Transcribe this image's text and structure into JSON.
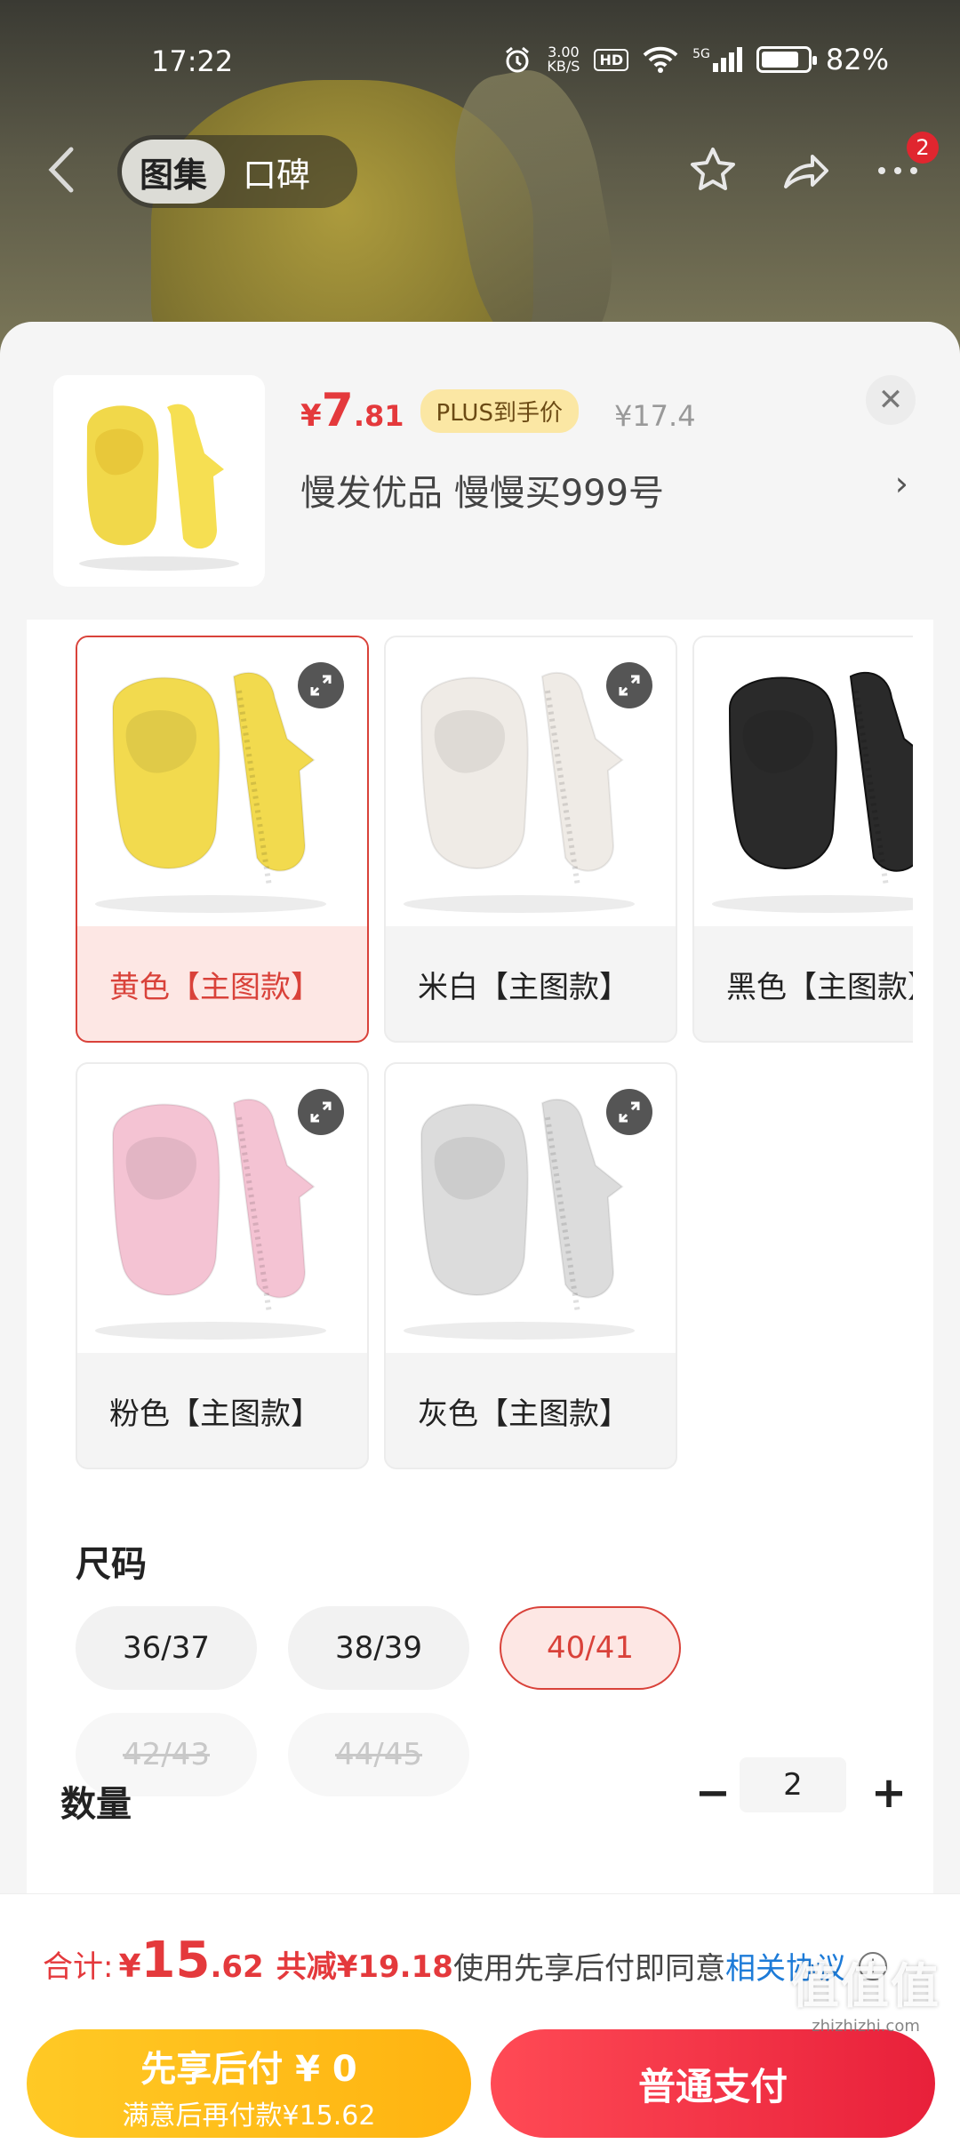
{
  "status_bar": {
    "time": "17:22",
    "net_speed_value": "3.00",
    "net_speed_unit": "KB/S",
    "hd": "HD",
    "signal_label": "5G",
    "battery": "82%",
    "battery_level": 0.82
  },
  "nav": {
    "tabs": [
      {
        "label": "图集",
        "active": true
      },
      {
        "label": "口碑",
        "active": false
      }
    ],
    "more_badge": "2",
    "icons": [
      "back-arrow-icon",
      "star-icon",
      "share-icon",
      "more-icon"
    ]
  },
  "product": {
    "price_currency": "¥",
    "price_int": "7",
    "price_dec": ".81",
    "price_tag": "PLUS到手价",
    "original_price": "¥17.4",
    "shop_name": "慢发优品  慢慢买999号",
    "close_glyph": "✕",
    "arrow_glyph": "›"
  },
  "colors": [
    {
      "label": "黄色【主图款】",
      "selected": true,
      "shoe_color": "#f2da4e"
    },
    {
      "label": "米白【主图款】",
      "selected": false,
      "shoe_color": "#efebe6"
    },
    {
      "label": "黑色【主图款】",
      "selected": false,
      "shoe_color": "#2a2a2a"
    },
    {
      "label": "粉色【主图款】",
      "selected": false,
      "shoe_color": "#f4c3d3"
    },
    {
      "label": "灰色【主图款】",
      "selected": false,
      "shoe_color": "#dcdcdc"
    }
  ],
  "size": {
    "title": "尺码",
    "options": [
      {
        "label": "36/37",
        "state": "normal"
      },
      {
        "label": "38/39",
        "state": "normal"
      },
      {
        "label": "40/41",
        "state": "selected"
      },
      {
        "label": "42/43",
        "state": "disabled"
      },
      {
        "label": "44/45",
        "state": "disabled"
      }
    ]
  },
  "quantity": {
    "title": "数量",
    "value": "2",
    "minus": "−",
    "plus": "+"
  },
  "footer": {
    "total_label": "合计:",
    "total_currency": "¥",
    "total_int": "15",
    "total_dec": ".62",
    "total_save": "共减¥19.18",
    "agree_text": "使用先享后付即同意",
    "agree_link": "相关协议",
    "info_glyph": "i",
    "pay_later_title": "先享后付 ¥ 0",
    "pay_later_sub": "满意后再付款¥15.62",
    "pay_normal": "普通支付"
  },
  "watermark": {
    "big": "值值值",
    "small": "zhizhizhi.com"
  },
  "theme": {
    "accent_red": "#e4393c",
    "plus_gold": "#fbe7a4",
    "pay_later_yellow": "#ffc925",
    "link_blue": "#1d7bd8"
  }
}
